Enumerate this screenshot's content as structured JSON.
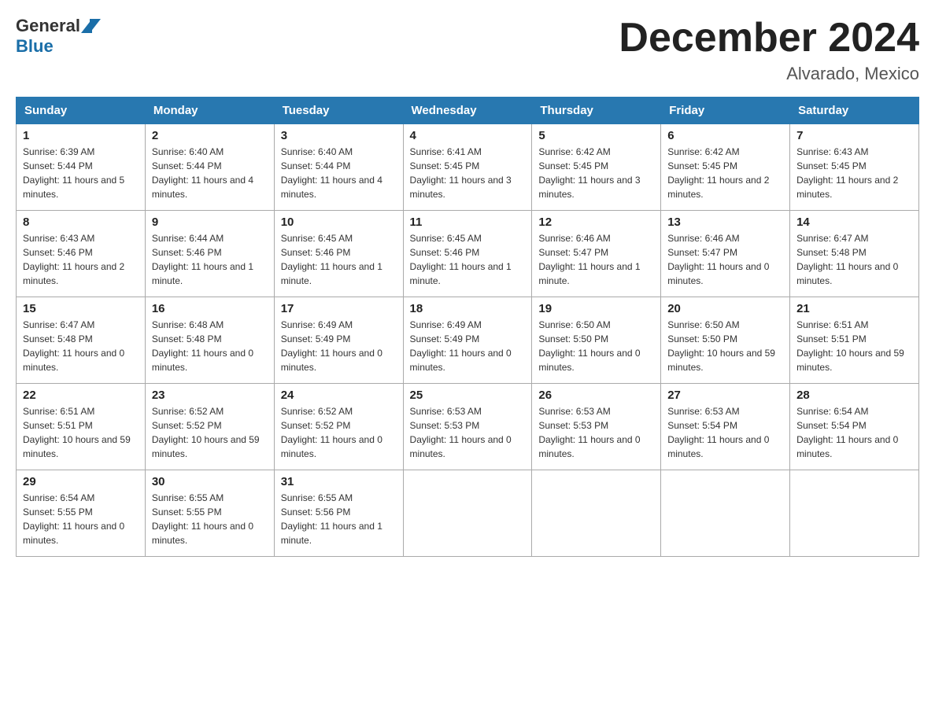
{
  "header": {
    "title": "December 2024",
    "subtitle": "Alvarado, Mexico",
    "logo_general": "General",
    "logo_blue": "Blue"
  },
  "days_of_week": [
    "Sunday",
    "Monday",
    "Tuesday",
    "Wednesday",
    "Thursday",
    "Friday",
    "Saturday"
  ],
  "weeks": [
    [
      {
        "num": "1",
        "sunrise": "6:39 AM",
        "sunset": "5:44 PM",
        "daylight": "11 hours and 5 minutes."
      },
      {
        "num": "2",
        "sunrise": "6:40 AM",
        "sunset": "5:44 PM",
        "daylight": "11 hours and 4 minutes."
      },
      {
        "num": "3",
        "sunrise": "6:40 AM",
        "sunset": "5:44 PM",
        "daylight": "11 hours and 4 minutes."
      },
      {
        "num": "4",
        "sunrise": "6:41 AM",
        "sunset": "5:45 PM",
        "daylight": "11 hours and 3 minutes."
      },
      {
        "num": "5",
        "sunrise": "6:42 AM",
        "sunset": "5:45 PM",
        "daylight": "11 hours and 3 minutes."
      },
      {
        "num": "6",
        "sunrise": "6:42 AM",
        "sunset": "5:45 PM",
        "daylight": "11 hours and 2 minutes."
      },
      {
        "num": "7",
        "sunrise": "6:43 AM",
        "sunset": "5:45 PM",
        "daylight": "11 hours and 2 minutes."
      }
    ],
    [
      {
        "num": "8",
        "sunrise": "6:43 AM",
        "sunset": "5:46 PM",
        "daylight": "11 hours and 2 minutes."
      },
      {
        "num": "9",
        "sunrise": "6:44 AM",
        "sunset": "5:46 PM",
        "daylight": "11 hours and 1 minute."
      },
      {
        "num": "10",
        "sunrise": "6:45 AM",
        "sunset": "5:46 PM",
        "daylight": "11 hours and 1 minute."
      },
      {
        "num": "11",
        "sunrise": "6:45 AM",
        "sunset": "5:46 PM",
        "daylight": "11 hours and 1 minute."
      },
      {
        "num": "12",
        "sunrise": "6:46 AM",
        "sunset": "5:47 PM",
        "daylight": "11 hours and 1 minute."
      },
      {
        "num": "13",
        "sunrise": "6:46 AM",
        "sunset": "5:47 PM",
        "daylight": "11 hours and 0 minutes."
      },
      {
        "num": "14",
        "sunrise": "6:47 AM",
        "sunset": "5:48 PM",
        "daylight": "11 hours and 0 minutes."
      }
    ],
    [
      {
        "num": "15",
        "sunrise": "6:47 AM",
        "sunset": "5:48 PM",
        "daylight": "11 hours and 0 minutes."
      },
      {
        "num": "16",
        "sunrise": "6:48 AM",
        "sunset": "5:48 PM",
        "daylight": "11 hours and 0 minutes."
      },
      {
        "num": "17",
        "sunrise": "6:49 AM",
        "sunset": "5:49 PM",
        "daylight": "11 hours and 0 minutes."
      },
      {
        "num": "18",
        "sunrise": "6:49 AM",
        "sunset": "5:49 PM",
        "daylight": "11 hours and 0 minutes."
      },
      {
        "num": "19",
        "sunrise": "6:50 AM",
        "sunset": "5:50 PM",
        "daylight": "11 hours and 0 minutes."
      },
      {
        "num": "20",
        "sunrise": "6:50 AM",
        "sunset": "5:50 PM",
        "daylight": "10 hours and 59 minutes."
      },
      {
        "num": "21",
        "sunrise": "6:51 AM",
        "sunset": "5:51 PM",
        "daylight": "10 hours and 59 minutes."
      }
    ],
    [
      {
        "num": "22",
        "sunrise": "6:51 AM",
        "sunset": "5:51 PM",
        "daylight": "10 hours and 59 minutes."
      },
      {
        "num": "23",
        "sunrise": "6:52 AM",
        "sunset": "5:52 PM",
        "daylight": "10 hours and 59 minutes."
      },
      {
        "num": "24",
        "sunrise": "6:52 AM",
        "sunset": "5:52 PM",
        "daylight": "11 hours and 0 minutes."
      },
      {
        "num": "25",
        "sunrise": "6:53 AM",
        "sunset": "5:53 PM",
        "daylight": "11 hours and 0 minutes."
      },
      {
        "num": "26",
        "sunrise": "6:53 AM",
        "sunset": "5:53 PM",
        "daylight": "11 hours and 0 minutes."
      },
      {
        "num": "27",
        "sunrise": "6:53 AM",
        "sunset": "5:54 PM",
        "daylight": "11 hours and 0 minutes."
      },
      {
        "num": "28",
        "sunrise": "6:54 AM",
        "sunset": "5:54 PM",
        "daylight": "11 hours and 0 minutes."
      }
    ],
    [
      {
        "num": "29",
        "sunrise": "6:54 AM",
        "sunset": "5:55 PM",
        "daylight": "11 hours and 0 minutes."
      },
      {
        "num": "30",
        "sunrise": "6:55 AM",
        "sunset": "5:55 PM",
        "daylight": "11 hours and 0 minutes."
      },
      {
        "num": "31",
        "sunrise": "6:55 AM",
        "sunset": "5:56 PM",
        "daylight": "11 hours and 1 minute."
      },
      null,
      null,
      null,
      null
    ]
  ],
  "sunrise_label": "Sunrise:",
  "sunset_label": "Sunset:",
  "daylight_label": "Daylight:"
}
